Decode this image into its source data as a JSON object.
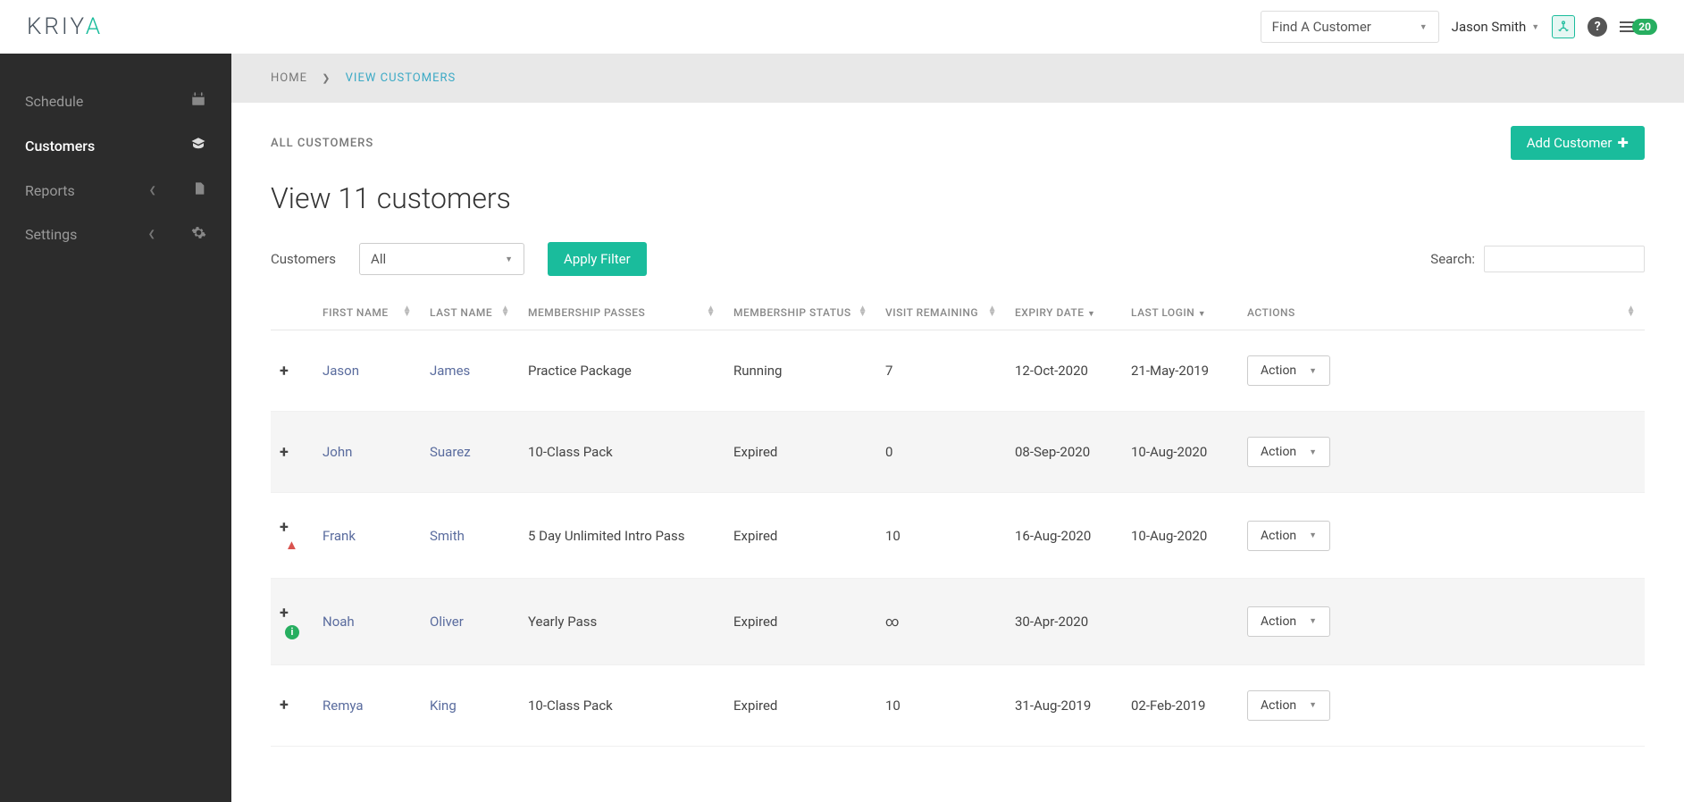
{
  "header": {
    "logo_text": "KRIYA",
    "find_customer": "Find A Customer",
    "user_name": "Jason Smith",
    "notif_count": "20"
  },
  "sidebar": {
    "items": [
      {
        "label": "Schedule",
        "active": false,
        "expandable": false
      },
      {
        "label": "Customers",
        "active": true,
        "expandable": false
      },
      {
        "label": "Reports",
        "active": false,
        "expandable": true
      },
      {
        "label": "Settings",
        "active": false,
        "expandable": true
      }
    ]
  },
  "breadcrumb": {
    "home": "HOME",
    "current": "VIEW CUSTOMERS"
  },
  "page": {
    "section_label": "ALL CUSTOMERS",
    "add_button": "Add Customer",
    "title": "View 11 customers",
    "filter_label": "Customers",
    "filter_selected": "All",
    "apply_button": "Apply Filter",
    "search_label": "Search:",
    "action_label": "Action"
  },
  "columns": {
    "first_name": "FIRST NAME",
    "last_name": "LAST NAME",
    "passes": "MEMBERSHIP PASSES",
    "status": "MEMBERSHIP STATUS",
    "visit": "VISIT REMAINING",
    "expiry": "EXPIRY DATE",
    "login": "LAST LOGIN",
    "actions": "ACTIONS"
  },
  "rows": [
    {
      "first": "Jason",
      "last": "James",
      "pass": "Practice Package",
      "status": "Running",
      "visit": "7",
      "expiry": "12-Oct-2020",
      "login": "21-May-2019",
      "icon": ""
    },
    {
      "first": "John",
      "last": "Suarez",
      "pass": "10-Class Pack",
      "status": "Expired",
      "visit": "0",
      "expiry": "08-Sep-2020",
      "login": "10-Aug-2020",
      "icon": ""
    },
    {
      "first": "Frank",
      "last": "Smith",
      "pass": "5 Day Unlimited Intro Pass",
      "status": "Expired",
      "visit": "10",
      "expiry": "16-Aug-2020",
      "login": "10-Aug-2020",
      "icon": "warn"
    },
    {
      "first": "Noah",
      "last": "Oliver",
      "pass": "Yearly Pass",
      "status": "Expired",
      "visit": "∞",
      "expiry": "30-Apr-2020",
      "login": "",
      "icon": "info"
    },
    {
      "first": "Remya",
      "last": "King",
      "pass": "10-Class Pack",
      "status": "Expired",
      "visit": "10",
      "expiry": "31-Aug-2019",
      "login": "02-Feb-2019",
      "icon": ""
    }
  ]
}
